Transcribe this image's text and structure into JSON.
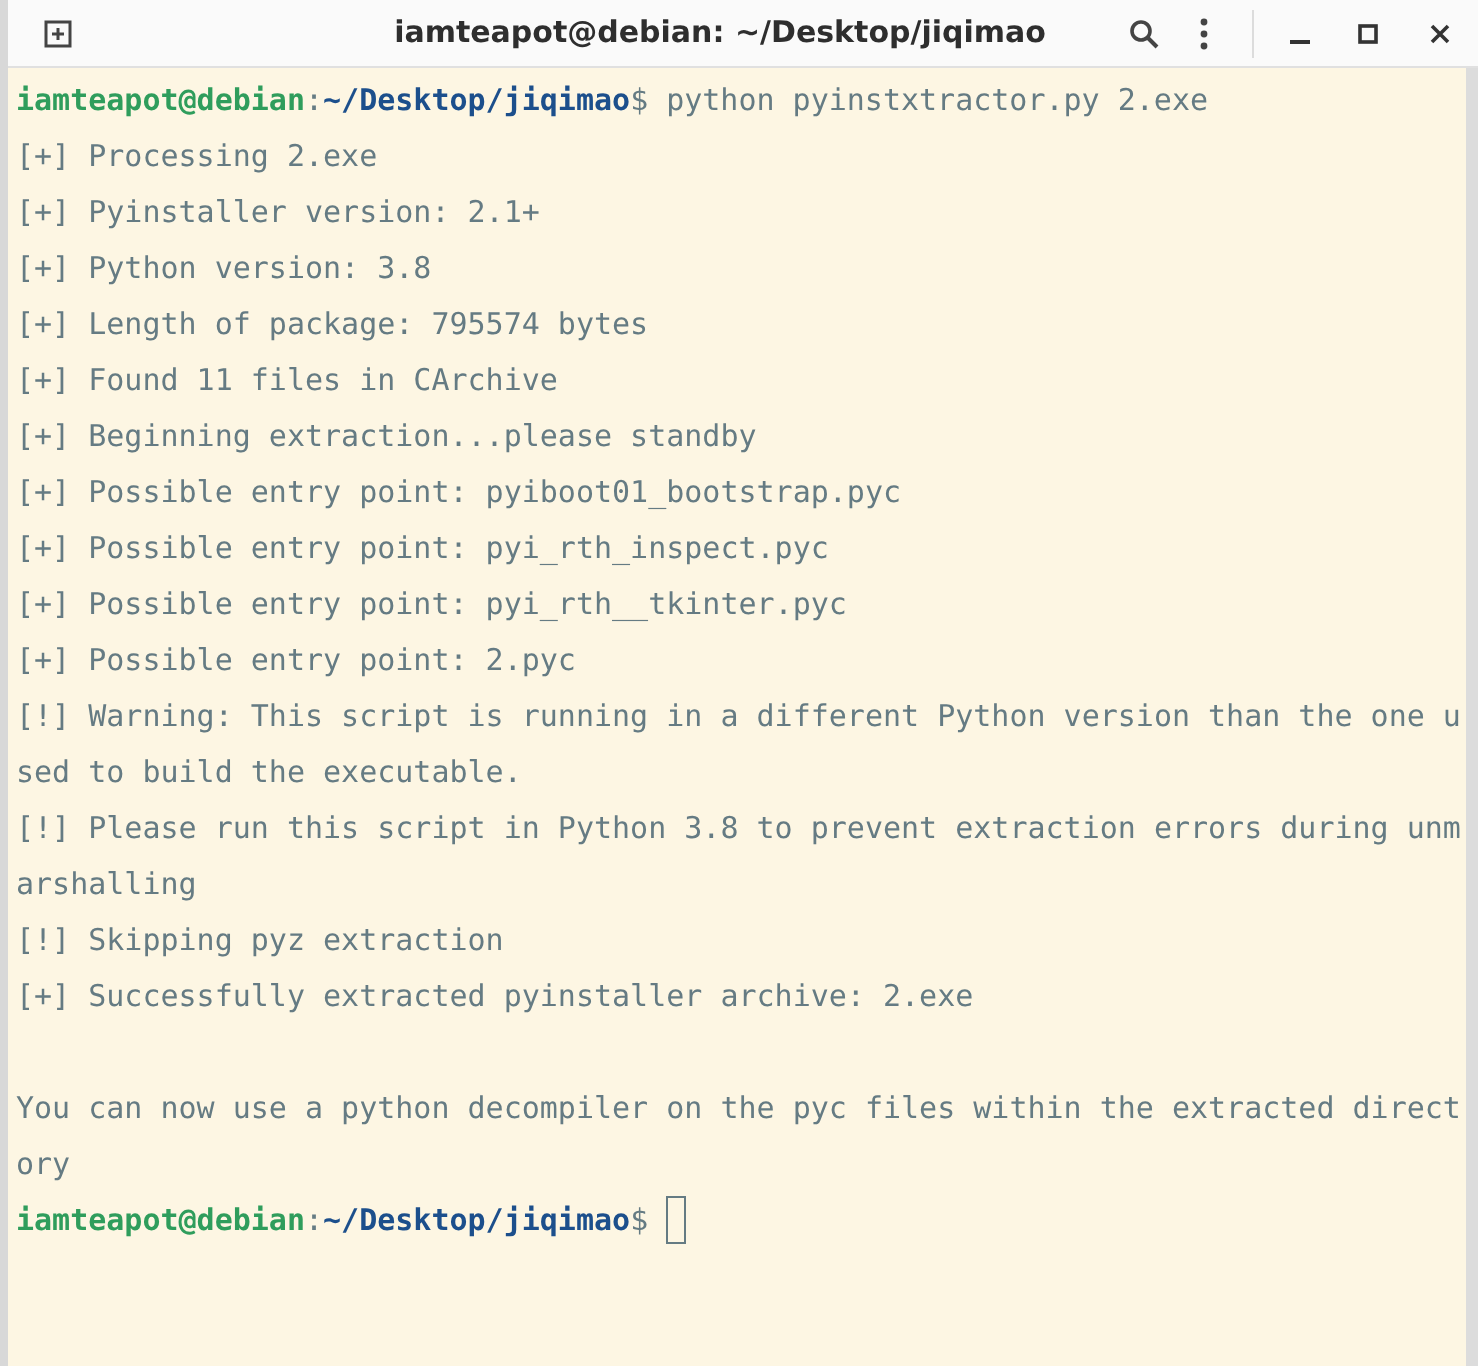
{
  "window": {
    "title": "iamteapot@debian: ~/Desktop/jiqimao"
  },
  "lines": [
    {
      "kind": "prompt",
      "user": "iamteapot@debian",
      "sep": ":",
      "path": "~/Desktop/jiqimao",
      "dollar": "$",
      "command": "python pyinstxtractor.py 2.exe",
      "cursor": false
    },
    {
      "kind": "output",
      "text": "[+] Processing 2.exe"
    },
    {
      "kind": "output",
      "text": "[+] Pyinstaller version: 2.1+"
    },
    {
      "kind": "output",
      "text": "[+] Python version: 3.8"
    },
    {
      "kind": "output",
      "text": "[+] Length of package: 795574 bytes"
    },
    {
      "kind": "output",
      "text": "[+] Found 11 files in CArchive"
    },
    {
      "kind": "output",
      "text": "[+] Beginning extraction...please standby"
    },
    {
      "kind": "output",
      "text": "[+] Possible entry point: pyiboot01_bootstrap.pyc"
    },
    {
      "kind": "output",
      "text": "[+] Possible entry point: pyi_rth_inspect.pyc"
    },
    {
      "kind": "output",
      "text": "[+] Possible entry point: pyi_rth__tkinter.pyc"
    },
    {
      "kind": "output",
      "text": "[+] Possible entry point: 2.pyc"
    },
    {
      "kind": "output",
      "text": "[!] Warning: This script is running in a different Python version than the one u"
    },
    {
      "kind": "output",
      "text": "sed to build the executable."
    },
    {
      "kind": "output",
      "text": "[!] Please run this script in Python 3.8 to prevent extraction errors during unm"
    },
    {
      "kind": "output",
      "text": "arshalling"
    },
    {
      "kind": "output",
      "text": "[!] Skipping pyz extraction"
    },
    {
      "kind": "output",
      "text": "[+] Successfully extracted pyinstaller archive: 2.exe"
    },
    {
      "kind": "blank"
    },
    {
      "kind": "output",
      "text": "You can now use a python decompiler on the pyc files within the extracted direct"
    },
    {
      "kind": "output",
      "text": "ory"
    },
    {
      "kind": "prompt",
      "user": "iamteapot@debian",
      "sep": ":",
      "path": "~/Desktop/jiqimao",
      "dollar": "$",
      "cursor": true
    }
  ]
}
